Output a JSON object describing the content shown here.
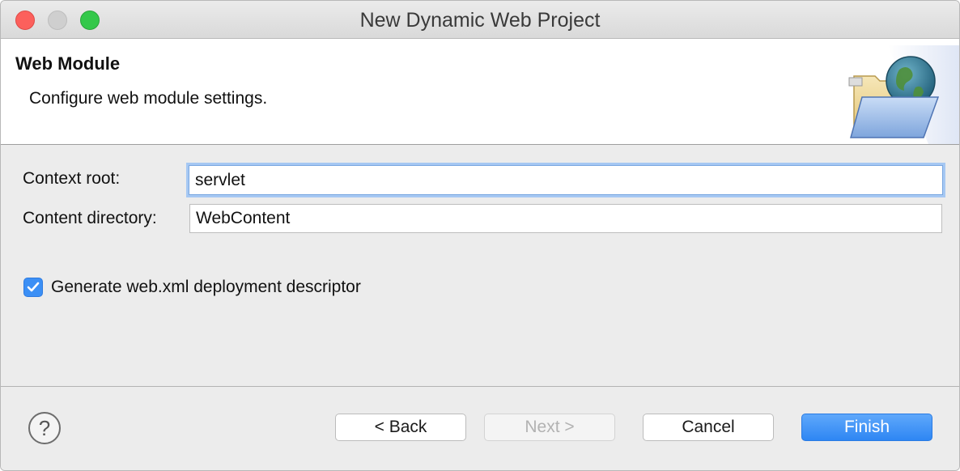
{
  "window": {
    "title": "New Dynamic Web Project"
  },
  "banner": {
    "title": "Web Module",
    "description": "Configure web module settings."
  },
  "form": {
    "context_root": {
      "label": "Context root:",
      "value": "servlet"
    },
    "content_directory": {
      "label": "Content directory:",
      "value": "WebContent"
    },
    "generate_descriptor": {
      "label": "Generate web.xml deployment descriptor",
      "checked": true
    }
  },
  "footer": {
    "help_icon": "help-icon",
    "back_label": "< Back",
    "next_label": "Next >",
    "cancel_label": "Cancel",
    "finish_label": "Finish"
  },
  "colors": {
    "accent": "#3b8ff5",
    "close": "#fc605c",
    "maximize": "#34c84a"
  }
}
